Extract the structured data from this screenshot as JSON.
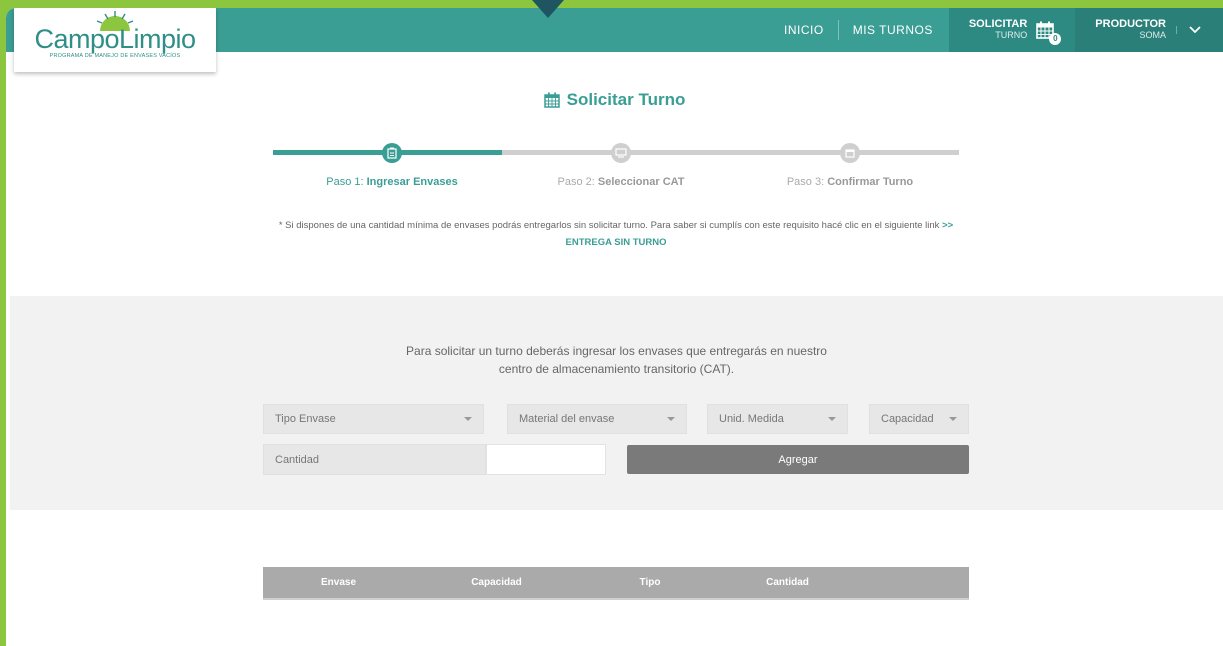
{
  "header": {
    "nav": [
      "INICIO",
      "MIS TURNOS"
    ],
    "solicitar": {
      "title": "SOLICITAR",
      "subtitle": "TURNO",
      "badge": "0"
    },
    "productor": {
      "title": "PRODUCTOR",
      "subtitle": "SOMA"
    }
  },
  "logo": {
    "name": "CampoLimpio",
    "tagline": "PROGRAMA DE MANEJO DE ENVASES VACÍOS"
  },
  "page": {
    "title": "Solicitar Turno"
  },
  "stepper": {
    "steps": [
      {
        "prefix": "Paso 1: ",
        "label": "Ingresar Envases"
      },
      {
        "prefix": "Paso 2: ",
        "label": "Seleccionar CAT"
      },
      {
        "prefix": "Paso 3: ",
        "label": "Confirmar Turno"
      }
    ]
  },
  "note": {
    "text": "* Si dispones de una cantidad mínima de envases podrás entregarlos sin solicitar turno. Para saber si cumplís con este requisito hacé clic en el siguiente link ",
    "link": ">> ENTREGA SIN TURNO"
  },
  "form": {
    "intro_line1": "Para solicitar un turno deberás ingresar los envases que entregarás en nuestro",
    "intro_line2": "centro de almacenamiento transitorio (CAT).",
    "tipo_envase": "Tipo Envase",
    "material": "Material del envase",
    "unidad": "Unid. Medida",
    "capacidad": "Capacidad",
    "cantidad": "Cantidad",
    "agregar": "Agregar"
  },
  "table": {
    "headers": [
      "Envase",
      "Capacidad",
      "Tipo",
      "Cantidad"
    ]
  },
  "colors": {
    "teal": "#3a9e95",
    "green": "#8cc63f",
    "gray": "#7a7a7a"
  }
}
